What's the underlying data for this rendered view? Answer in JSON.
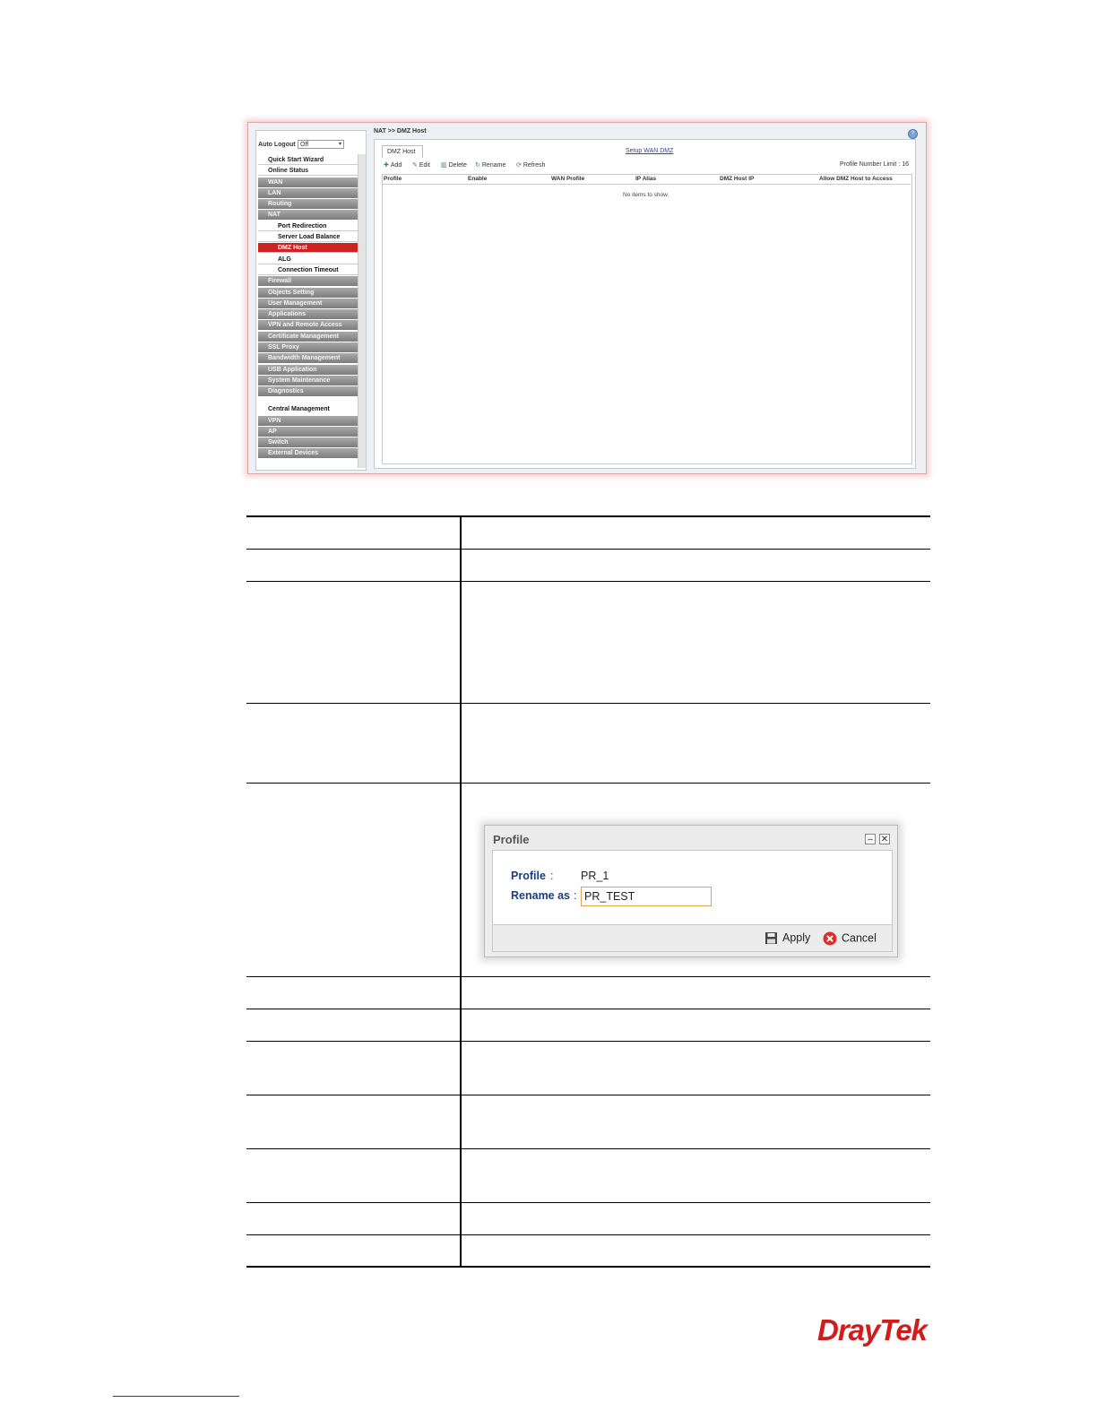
{
  "screenshot": {
    "sidebar": {
      "auto_logout_label": "Auto Logout",
      "auto_logout_value": "Off",
      "menu": [
        {
          "label": "Quick Start Wizard",
          "style": "white"
        },
        {
          "label": "Online Status",
          "style": "white"
        },
        {
          "label": "WAN",
          "style": "grey"
        },
        {
          "label": "LAN",
          "style": "grey"
        },
        {
          "label": "Routing",
          "style": "grey"
        },
        {
          "label": "NAT",
          "style": "grey"
        },
        {
          "label": "Port Redirection",
          "style": "sub"
        },
        {
          "label": "Server Load Balance",
          "style": "sub"
        },
        {
          "label": "DMZ Host",
          "style": "sub active"
        },
        {
          "label": "ALG",
          "style": "sub"
        },
        {
          "label": "Connection Timeout",
          "style": "sub"
        },
        {
          "label": "Firewall",
          "style": "grey"
        },
        {
          "label": "Objects Setting",
          "style": "grey"
        },
        {
          "label": "User Management",
          "style": "grey"
        },
        {
          "label": "Applications",
          "style": "grey"
        },
        {
          "label": "VPN and Remote Access",
          "style": "grey"
        },
        {
          "label": "Certificate Management",
          "style": "grey"
        },
        {
          "label": "SSL Proxy",
          "style": "grey"
        },
        {
          "label": "Bandwidth Management",
          "style": "grey"
        },
        {
          "label": "USB Application",
          "style": "grey"
        },
        {
          "label": "System Maintenance",
          "style": "grey"
        },
        {
          "label": "Diagnostics",
          "style": "grey"
        },
        {
          "label": "Central Management",
          "style": "section"
        },
        {
          "label": "VPN",
          "style": "grey"
        },
        {
          "label": "AP",
          "style": "grey"
        },
        {
          "label": "Switch",
          "style": "grey"
        },
        {
          "label": "External Devices",
          "style": "grey"
        }
      ]
    },
    "breadcrumb": "NAT >> DMZ Host",
    "tab_label": "DMZ Host",
    "setup_link": "Setup WAN DMZ",
    "toolbar": {
      "add": "Add",
      "edit": "Edit",
      "delete": "Delete",
      "rename": "Rename",
      "refresh": "Refresh",
      "limit": "Profile Number Limit : 16"
    },
    "columns": [
      "Profile",
      "Enable",
      "WAN Profile",
      "IP Alias",
      "DMZ Host IP",
      "Allow DMZ Host to Access"
    ],
    "empty_message": "No items to show."
  },
  "dialog": {
    "title": "Profile",
    "profile_label": "Profile",
    "profile_value": "PR_1",
    "rename_label": "Rename as",
    "rename_value": "PR_TEST",
    "apply": "Apply",
    "cancel": "Cancel"
  },
  "logo": "DrayTek"
}
